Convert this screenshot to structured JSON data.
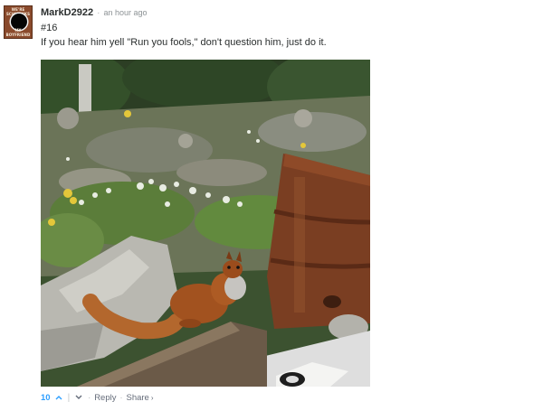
{
  "comment": {
    "avatar": {
      "alt_icon": "eclipse-avatar-icon",
      "top_text": "WE'RE SCHMUCKS",
      "bottom_text": "MY BOYFRIEND"
    },
    "username": "MarkD2922",
    "separator": "·",
    "timestamp": "an hour ago",
    "number": "#16",
    "text": "If you hear him yell \"Run you fools,\" don't question him, just do it.",
    "image_icon": "squirrel-photo"
  },
  "footer": {
    "vote_count": "10",
    "upvote_icon": "chevron-up-icon",
    "divider": "|",
    "downvote_icon": "chevron-down-icon",
    "reply_label": "Reply",
    "dot": "·",
    "share_label": "Share",
    "share_chevron": "›",
    "colors": {
      "vote_accent": "#2e9fff",
      "action_text": "#656c7a"
    }
  }
}
